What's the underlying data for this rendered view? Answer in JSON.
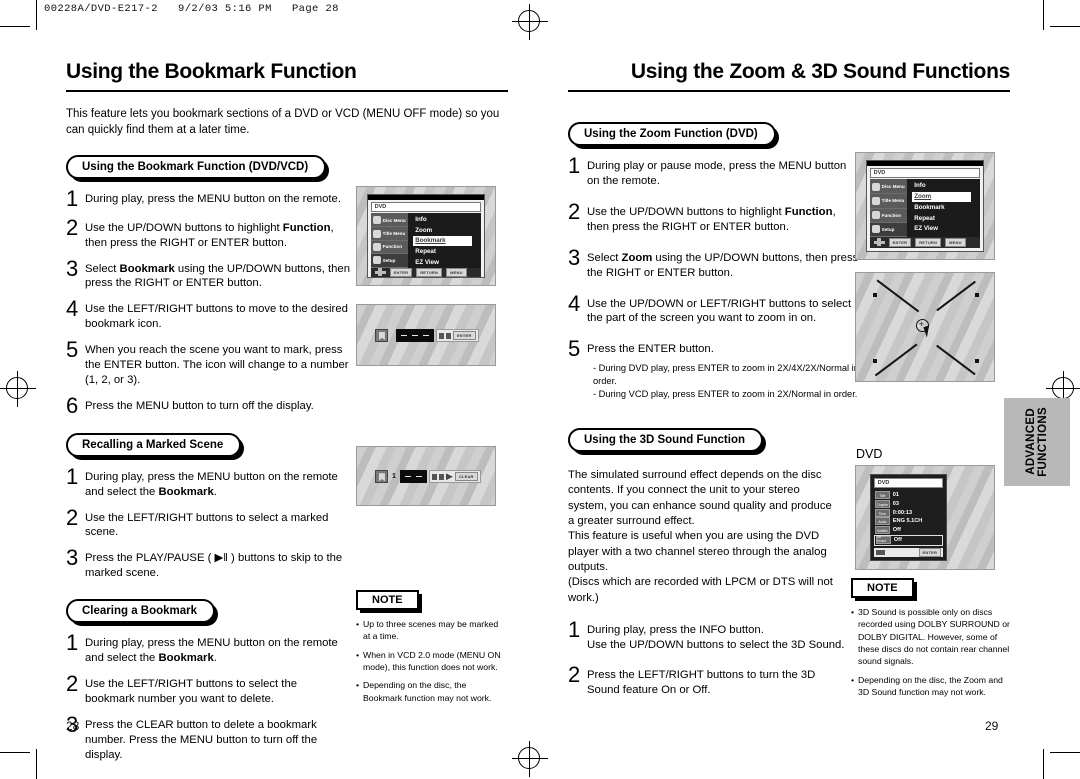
{
  "slug": "00228A/DVD-E217-2   9/2/03 5:16 PM   Page 28",
  "side_tab": "ADVANCED\nFUNCTIONS",
  "left_page": {
    "title": "Using the Bookmark Function",
    "page_number": "28",
    "intro": "This feature lets you bookmark sections of a DVD or VCD (MENU OFF mode) so you can quickly find them at a later time.",
    "section1": {
      "heading": "Using the Bookmark Function (DVD/VCD)",
      "steps": [
        {
          "num": "1",
          "text": "During play, press the MENU button on the remote."
        },
        {
          "num": "2",
          "text": "Use the UP/DOWN buttons to highlight <b>Function</b>, then press the RIGHT or ENTER button."
        },
        {
          "num": "3",
          "text": "Select <b>Bookmark</b> using the UP/DOWN buttons, then press the RIGHT or ENTER button."
        },
        {
          "num": "4",
          "text": "Use the LEFT/RIGHT buttons to move to the desired bookmark icon."
        },
        {
          "num": "5",
          "text": "When you reach the scene you want to mark, press the ENTER button. The icon will change to a number (1, 2, or 3)."
        },
        {
          "num": "6",
          "text": "Press the MENU button to turn off the display."
        }
      ]
    },
    "section2": {
      "heading": "Recalling a Marked Scene",
      "steps": [
        {
          "num": "1",
          "text": "During play, press the MENU button on the remote and select the <b>Bookmark</b>."
        },
        {
          "num": "2",
          "text": "Use the LEFT/RIGHT buttons to select a marked scene."
        },
        {
          "num": "3",
          "text": "Press the PLAY/PAUSE ( ▶‖ ) buttons to skip to the marked scene."
        }
      ]
    },
    "section3": {
      "heading": "Clearing a Bookmark",
      "steps": [
        {
          "num": "1",
          "text": "During play, press the MENU button on the remote and select the <b>Bookmark</b>."
        },
        {
          "num": "2",
          "text": "Use the LEFT/RIGHT buttons to select the bookmark number you want to delete."
        },
        {
          "num": "3",
          "text": "Press the CLEAR button to delete a bookmark number. Press the MENU button to turn off the display."
        }
      ]
    },
    "note": {
      "label": "NOTE",
      "items": [
        "Up to three scenes may be marked at a time.",
        "When in VCD 2.0 mode (MENU ON mode), this function does not work.",
        "Depending on the disc, the Bookmark function may not work."
      ]
    },
    "osd_menu": {
      "disc_label": "DVD",
      "side_items": [
        "Disc Menu",
        "Title Menu",
        "Function",
        "Setup"
      ],
      "items": [
        "Info",
        "Zoom",
        "Bookmark",
        "Repeat",
        "EZ View"
      ],
      "selected": "Bookmark",
      "keys": [
        "ENTER",
        "RETURN",
        "MENU"
      ]
    },
    "bookmark_strip_1": {
      "number": "",
      "keys": [
        "ENTER"
      ]
    },
    "bookmark_strip_2": {
      "number": "1",
      "keys": [
        "CLEAR"
      ]
    }
  },
  "right_page": {
    "title": "Using the Zoom & 3D Sound Functions",
    "page_number": "29",
    "section1": {
      "heading": "Using the Zoom Function (DVD)",
      "steps": [
        {
          "num": "1",
          "text": "During play or pause mode, press the MENU button on the remote."
        },
        {
          "num": "2",
          "text": "Use the UP/DOWN buttons to highlight <b>Function</b>, then press the RIGHT or ENTER button."
        },
        {
          "num": "3",
          "text": "Select <b>Zoom</b> using the UP/DOWN buttons, then press the RIGHT or ENTER button."
        },
        {
          "num": "4",
          "text": "Use the UP/DOWN or LEFT/RIGHT buttons to select the part of the screen you want to zoom in on."
        },
        {
          "num": "5",
          "text": "Press the ENTER button."
        }
      ],
      "substeps": [
        "- During DVD play, press ENTER to zoom in 2X/4X/2X/Normal in order.",
        "- During VCD play, press ENTER to zoom in 2X/Normal in order."
      ]
    },
    "section2": {
      "heading": "Using the 3D Sound Function",
      "paragraph": "The simulated surround effect depends on the disc contents. If you connect the unit to your stereo system, you can enhance sound quality and produce a greater surround effect.\nThis feature is useful when you are using the DVD player with a two channel stereo through the analog outputs.\n(Discs which are recorded with LPCM or DTS will not work.)",
      "steps": [
        {
          "num": "1",
          "text": "During play, press the INFO button.<br>Use the UP/DOWN buttons to select the 3D Sound."
        },
        {
          "num": "2",
          "text": "Press the LEFT/RIGHT buttons to turn the 3D Sound feature On or Off."
        }
      ]
    },
    "note": {
      "label": "NOTE",
      "items": [
        "3D Sound is possible only on discs recorded using DOLBY SURROUND or DOLBY DIGITAL. However, some of these discs do not contain rear channel sound signals.",
        "Depending on the disc, the Zoom and 3D Sound function may not work."
      ]
    },
    "osd_menu": {
      "disc_label": "DVD",
      "side_items": [
        "Disc Menu",
        "Title Menu",
        "Function",
        "Setup"
      ],
      "items": [
        "Info",
        "Zoom",
        "Bookmark",
        "Repeat",
        "EZ View"
      ],
      "selected": "Zoom",
      "keys": [
        "ENTER",
        "RETURN",
        "MENU"
      ]
    },
    "dvd_caption": "DVD",
    "osd_info": {
      "disc_label": "DVD",
      "rows": [
        {
          "icon": "Title",
          "value": "01"
        },
        {
          "icon": "Chapter",
          "value": "03"
        },
        {
          "icon": "Time",
          "value": "0:00:13"
        },
        {
          "icon": "Audio",
          "value": "ENG 5.1CH"
        },
        {
          "icon": "Subtitle",
          "value": "Off"
        },
        {
          "icon": "3D Sound",
          "value": "Off"
        }
      ],
      "selected_row": "3D Sound",
      "key": "ENTER"
    }
  }
}
